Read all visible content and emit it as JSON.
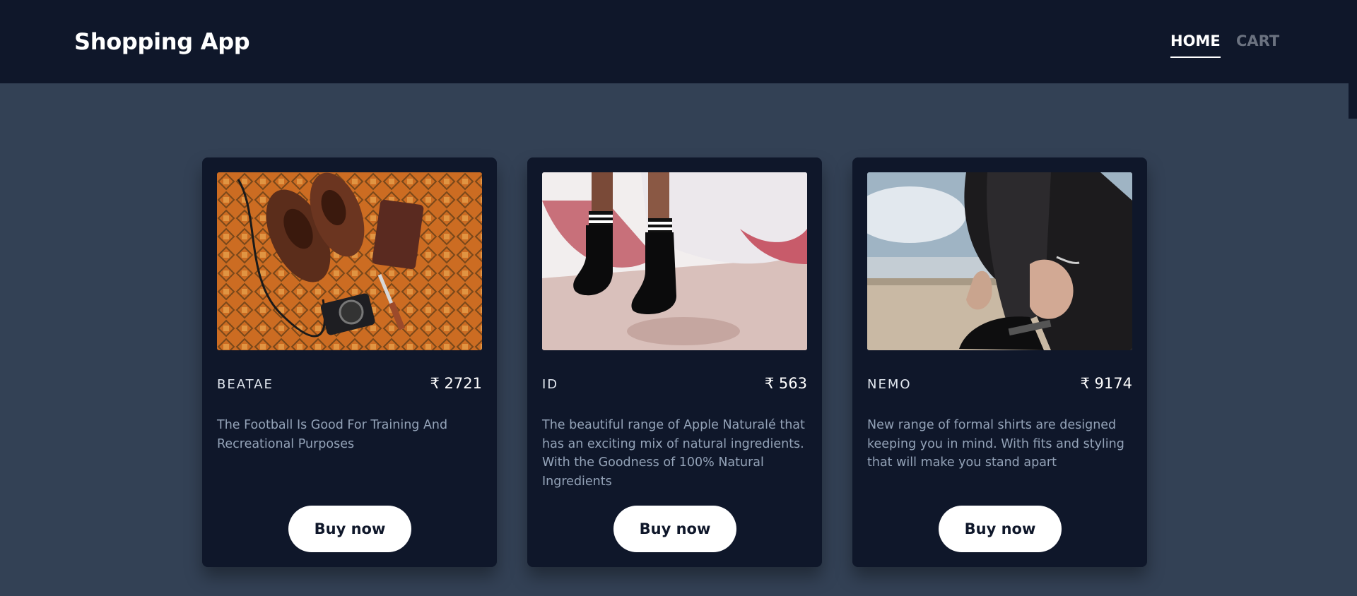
{
  "app": {
    "brand": "Shopping App"
  },
  "nav": {
    "home": "HOME",
    "cart": "CART"
  },
  "products": [
    {
      "name": "BEATAE",
      "price": "₹ 2721",
      "description": "The Football Is Good For Training And Recreational Purposes",
      "button": "Buy now",
      "image_icon": "shoes-camera-photo"
    },
    {
      "name": "ID",
      "price": "₹ 563",
      "description": "The beautiful range of Apple Naturalé that has an exciting mix of natural ingredients. With the Goodness of 100% Natural Ingredients",
      "button": "Buy now",
      "image_icon": "boots-photo"
    },
    {
      "name": "NEMO",
      "price": "₹ 9174",
      "description": "New range of formal shirts are designed keeping you in mind. With fits and styling that will make you stand apart",
      "button": "Buy now",
      "image_icon": "boot-lacing-photo"
    }
  ],
  "colors": {
    "navbar": "#0f172a",
    "page_bg": "#334155",
    "card_bg": "#0f172a",
    "button_bg": "#ffffff",
    "muted_link": "#6b7280"
  }
}
